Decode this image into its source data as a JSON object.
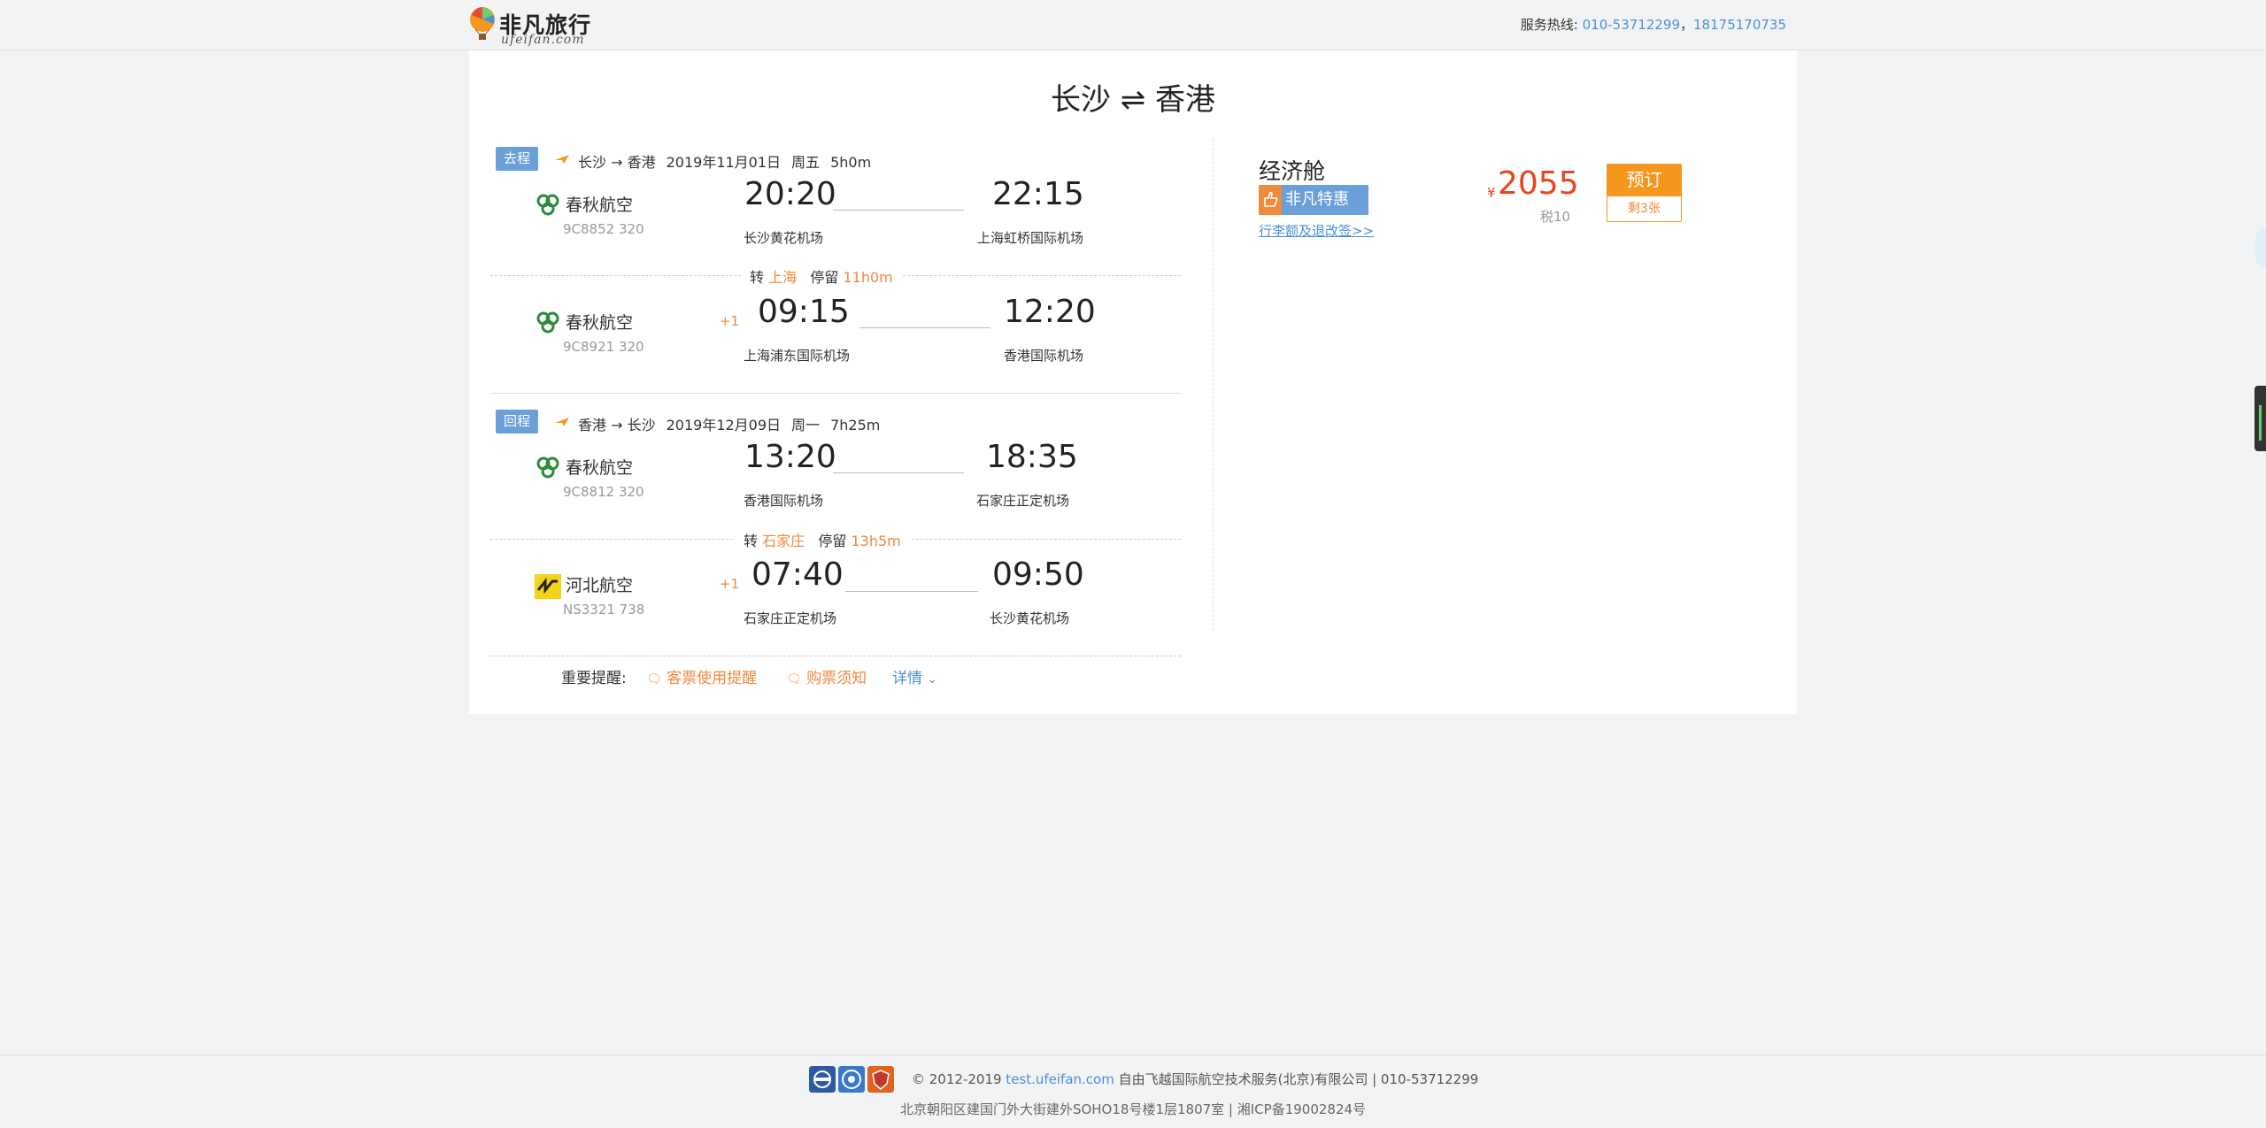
{
  "header": {
    "logo_text": "非凡旅行",
    "logo_sub": "ufeifan.com",
    "hotline_label": "服务热线:",
    "hotline_1": "010-53712299",
    "hotline_sep": "，",
    "hotline_2": "18175170735"
  },
  "route_title": "长沙 ⇌ 香港",
  "outbound": {
    "tag": "去程",
    "route": "长沙 → 香港",
    "date": "2019年11月01日",
    "weekday": "周五",
    "duration": "5h0m",
    "legs": [
      {
        "airline": "春秋航空",
        "flight": "9C8852 320",
        "plus1": "",
        "dep_time": "20:20",
        "arr_time": "22:15",
        "dep_airport": "长沙黄花机场",
        "arr_airport": "上海虹桥国际机场"
      },
      {
        "airline": "春秋航空",
        "flight": "9C8921 320",
        "plus1": "+1",
        "dep_time": "09:15",
        "arr_time": "12:20",
        "dep_airport": "上海浦东国际机场",
        "arr_airport": "香港国际机场"
      }
    ],
    "transfer": {
      "label": "转",
      "city": "上海",
      "stay_label": "停留",
      "stay": "11h0m"
    }
  },
  "return": {
    "tag": "回程",
    "route": "香港 → 长沙",
    "date": "2019年12月09日",
    "weekday": "周一",
    "duration": "7h25m",
    "legs": [
      {
        "airline": "春秋航空",
        "flight": "9C8812 320",
        "plus1": "",
        "dep_time": "13:20",
        "arr_time": "18:35",
        "dep_airport": "香港国际机场",
        "arr_airport": "石家庄正定机场"
      },
      {
        "airline": "河北航空",
        "flight": "NS3321 738",
        "plus1": "+1",
        "dep_time": "07:40",
        "arr_time": "09:50",
        "dep_airport": "石家庄正定机场",
        "arr_airport": "长沙黄花机场"
      }
    ],
    "transfer": {
      "label": "转",
      "city": "石家庄",
      "stay_label": "停留",
      "stay": "13h5m"
    }
  },
  "notices": {
    "label": "重要提醒:",
    "link1": "客票使用提醒",
    "link2": "购票须知",
    "detail": "详情",
    "detail_chevron": "⌄"
  },
  "fare": {
    "cabin": "经济舱",
    "promo": "非凡特惠",
    "baggage_link": "行李额及退改签>>",
    "currency": "¥",
    "price": "2055",
    "tax": "税10",
    "book_label": "预订",
    "remaining": "剩3张"
  },
  "footer": {
    "copyright": "© 2012-2019 ",
    "site": "test.ufeifan.com",
    "company": " 自由飞越国际航空技术服务(北京)有限公司 | 010-53712299",
    "address": "北京朝阳区建国门外大街建外SOHO18号楼1层1807室 | 湘ICP备19002824号"
  },
  "colors": {
    "accent_orange": "#f5961d",
    "price_red": "#e8441e",
    "tag_blue": "#6a9fd8",
    "link_blue": "#4a90d9"
  },
  "icons": {
    "spring_airlines": "spring-airlines-logo-icon",
    "hebei_airlines": "hebei-airlines-logo-icon",
    "plane": "plane-icon",
    "chat": "chat-bubble-icon",
    "thumb": "thumbs-up-icon"
  }
}
